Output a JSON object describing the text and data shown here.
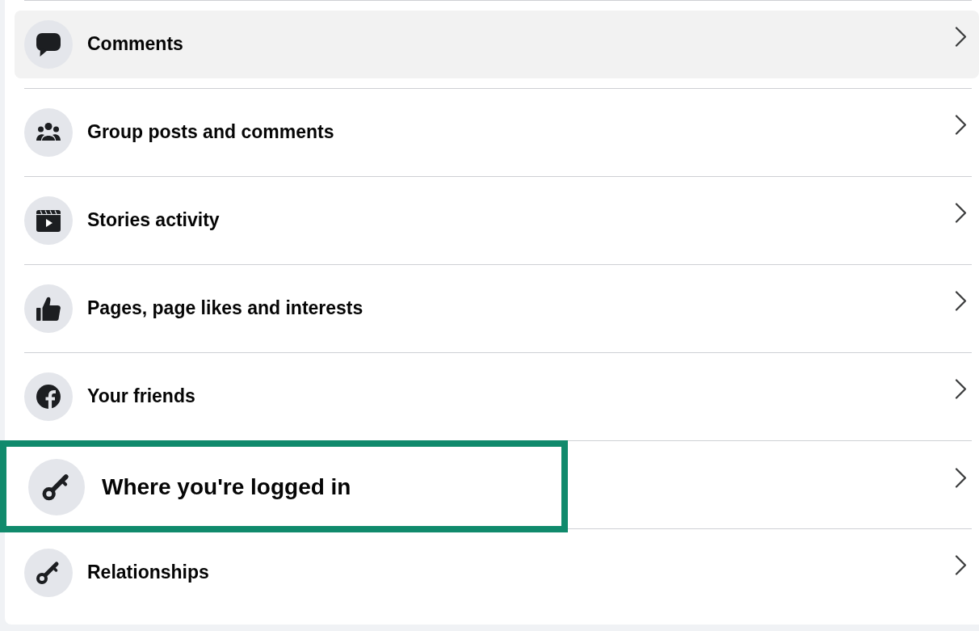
{
  "settings_list": {
    "items": [
      {
        "label": "Comments",
        "hovered": true,
        "highlighted": false
      },
      {
        "label": "Group posts and comments",
        "hovered": false,
        "highlighted": false
      },
      {
        "label": "Stories activity",
        "hovered": false,
        "highlighted": false
      },
      {
        "label": "Pages, page likes and interests",
        "hovered": false,
        "highlighted": false
      },
      {
        "label": "Your friends",
        "hovered": false,
        "highlighted": false
      },
      {
        "label": "Where you're logged in",
        "hovered": false,
        "highlighted": true
      },
      {
        "label": "Relationships",
        "hovered": false,
        "highlighted": false
      }
    ]
  }
}
